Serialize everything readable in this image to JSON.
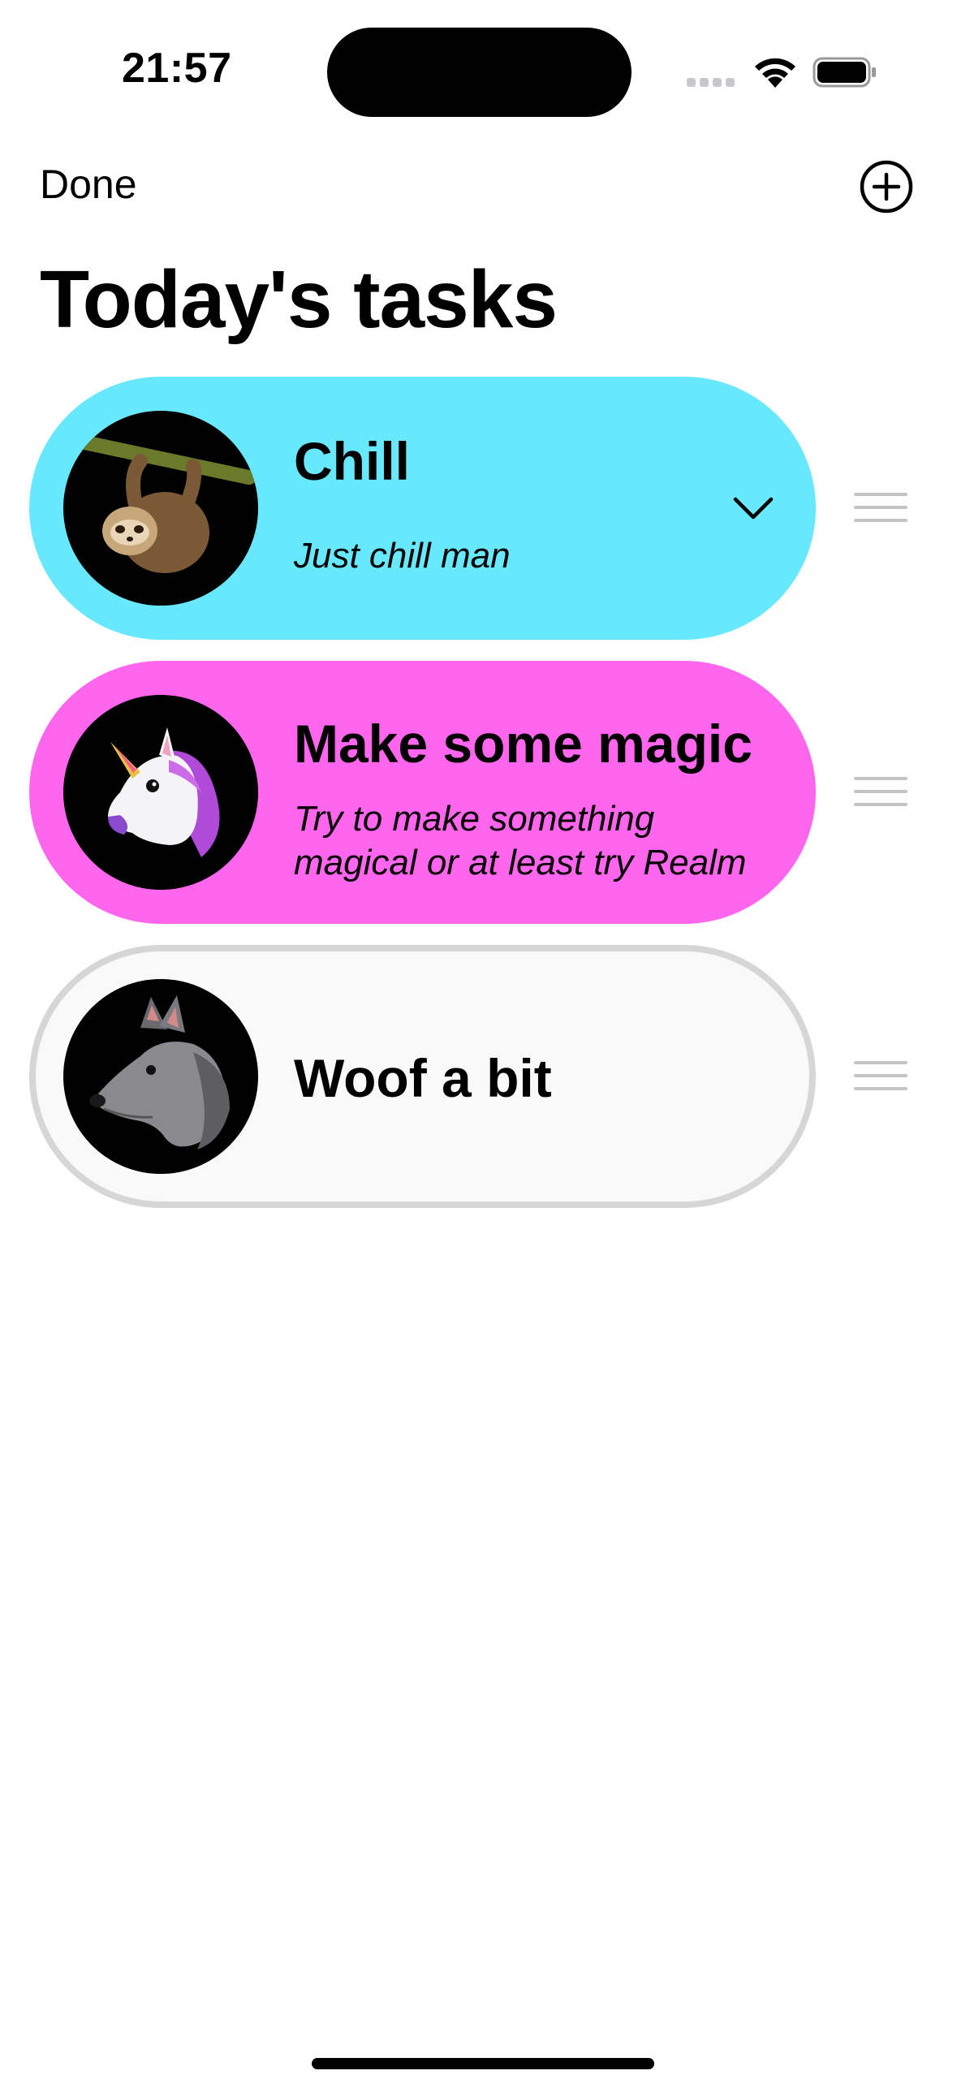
{
  "status_bar": {
    "time": "21:57",
    "icons": [
      "cellular-signal-icon",
      "wifi-icon",
      "battery-icon"
    ]
  },
  "nav": {
    "done_label": "Done",
    "add_icon": "plus-circle-icon"
  },
  "page": {
    "title": "Today's tasks"
  },
  "tasks": [
    {
      "title": "Chill",
      "subtitle": "Just chill man",
      "avatar": "sloth-icon",
      "color": "#67e8fc",
      "expanded_indicator": "chevron-down-icon"
    },
    {
      "title": "Make some magic",
      "subtitle_lines": [
        "Try to make something",
        "magical or at least try Realm"
      ],
      "avatar": "unicorn-icon",
      "color": "#ff66ed"
    },
    {
      "title": "Woof a bit",
      "avatar": "wolf-icon",
      "color": "#f9f9f9"
    }
  ]
}
